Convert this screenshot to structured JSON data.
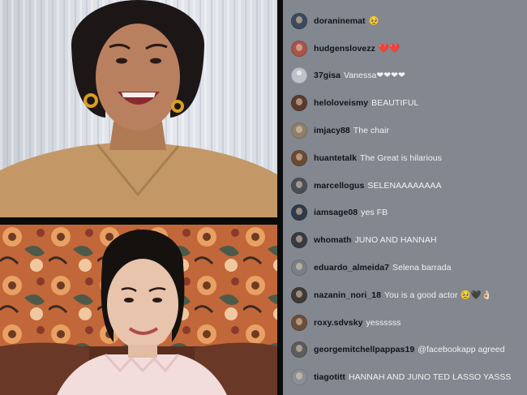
{
  "chat": {
    "comments": [
      {
        "username": "doraninemat",
        "message": "🥹",
        "avatar_color": "#3b4a5c"
      },
      {
        "username": "hudgenslovezz",
        "message": "❤️❤️",
        "avatar_color": "#a7554c"
      },
      {
        "username": "37gisa",
        "message": "Vanessa❤❤❤❤",
        "avatar_color": "#bfc3c9",
        "avatar_placeholder": true
      },
      {
        "username": "heloloveismy",
        "message": "BEAUTIFUL",
        "avatar_color": "#5a3a30"
      },
      {
        "username": "imjacy88",
        "message": "The chair",
        "avatar_color": "#8e7f6a"
      },
      {
        "username": "huantetalk",
        "message": "The Great is hilarious",
        "avatar_color": "#6b4a35"
      },
      {
        "username": "marcellogus",
        "message": "SELENAAAAAAAA",
        "avatar_color": "#4a4e55"
      },
      {
        "username": "iamsage08",
        "message": "yes FB",
        "avatar_color": "#2f3b4a"
      },
      {
        "username": "whomath",
        "message": "JUNO AND HANNAH",
        "avatar_color": "#383c42"
      },
      {
        "username": "eduardo_almeida7",
        "message": "Selena barrada",
        "avatar_color": "#7a7f86"
      },
      {
        "username": "nazanin_nori_18",
        "message": "You is a good actor 🥹🖤👌🏻",
        "avatar_color": "#3e3a39"
      },
      {
        "username": "roxy.sdvsky",
        "message": "yessssss",
        "avatar_color": "#6a4e3d"
      },
      {
        "username": "georgemitchellpappas19",
        "message": "@facebookapp agreed",
        "avatar_color": "#5c5c5c"
      },
      {
        "username": "tiagotitt",
        "message": "HANNAH AND JUNO TED LASSO YASSS",
        "avatar_color": "#8a8f95"
      }
    ]
  }
}
